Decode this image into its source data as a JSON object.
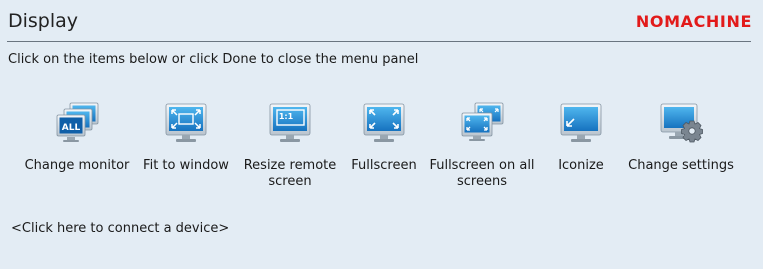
{
  "header": {
    "title": "Display",
    "logo": "NOMACHINE"
  },
  "instructions": "Click on the items below or click Done to close the menu panel",
  "items": [
    {
      "label": "Change monitor",
      "icon": "change-monitor-icon",
      "badge": "ALL"
    },
    {
      "label": "Fit to window",
      "icon": "fit-to-window-icon"
    },
    {
      "label": "Resize remote screen",
      "icon": "resize-remote-screen-icon",
      "badge": "1:1"
    },
    {
      "label": "Fullscreen",
      "icon": "fullscreen-icon"
    },
    {
      "label": "Fullscreen on all screens",
      "icon": "fullscreen-all-screens-icon"
    },
    {
      "label": "Iconize",
      "icon": "iconize-icon"
    },
    {
      "label": "Change settings",
      "icon": "change-settings-icon"
    }
  ],
  "connect_link": "<Click here to connect a device>",
  "colors": {
    "accent": "#1e88d0",
    "logo": "#e21a1a",
    "background": "#e3ecf4"
  }
}
